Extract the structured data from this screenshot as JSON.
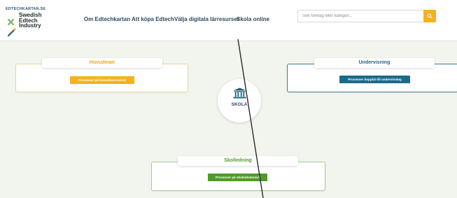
{
  "header": {
    "logo": {
      "site": "EDTECHKARTAN.SE",
      "line1": "Swedish",
      "line2": "Edtech",
      "line3": "Industry"
    },
    "nav": [
      {
        "label": "Om Edtechkartan"
      },
      {
        "label": "Att köpa Edtech"
      },
      {
        "label": "Välja digitala lärresurser"
      },
      {
        "label": "Skola online"
      }
    ],
    "search": {
      "placeholder": "Sök företag eller kategori...",
      "icon": "search-icon"
    }
  },
  "diagram": {
    "hub": {
      "label": "SKOLA",
      "icon": "institution-icon"
    },
    "cards": {
      "huvudman": {
        "title": "Huvudman",
        "button": "Processer på huvudmannanivå",
        "color": "#f5b21b"
      },
      "undervisning": {
        "title": "Undervisning",
        "button": "Processer kopplat till undervisning",
        "color": "#1c6a8a"
      },
      "skolledning": {
        "title": "Skolledning",
        "button": "Processer på skolenhetsnivå",
        "color": "#4f9a2e"
      }
    }
  },
  "colors": {
    "background": "#f2f5ee",
    "accent": "#f5b21b",
    "nav_text": "#2c4a60"
  }
}
